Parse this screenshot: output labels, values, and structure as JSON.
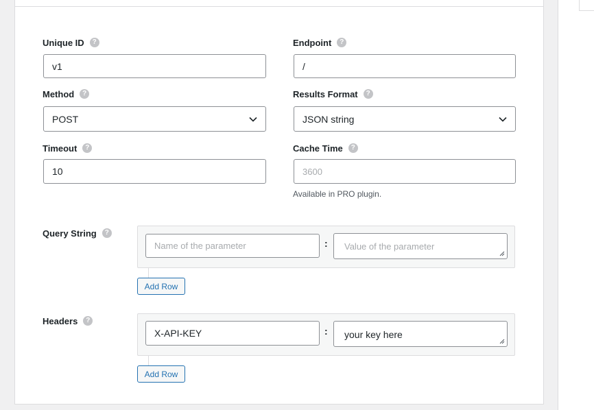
{
  "fields": {
    "unique_id": {
      "label": "Unique ID",
      "value": "v1"
    },
    "endpoint": {
      "label": "Endpoint",
      "value": "/"
    },
    "method": {
      "label": "Method",
      "value": "POST"
    },
    "results_format": {
      "label": "Results Format",
      "value": "JSON string"
    },
    "timeout": {
      "label": "Timeout",
      "value": "10"
    },
    "cache_time": {
      "label": "Cache Time",
      "placeholder": "3600",
      "note": "Available in PRO plugin."
    }
  },
  "query_string": {
    "label": "Query String",
    "name_placeholder": "Name of the parameter",
    "value_placeholder": "Value of the parameter",
    "separator": ":",
    "add_row_label": "Add Row"
  },
  "headers": {
    "label": "Headers",
    "name_value": "X-API-KEY",
    "value_value": "your key here",
    "separator": ":",
    "add_row_label": "Add Row"
  },
  "help_glyph": "?",
  "icons": {
    "help": "question-circle-icon",
    "dropdown": "chevron-down-icon",
    "resize": "resize-grip-icon"
  }
}
